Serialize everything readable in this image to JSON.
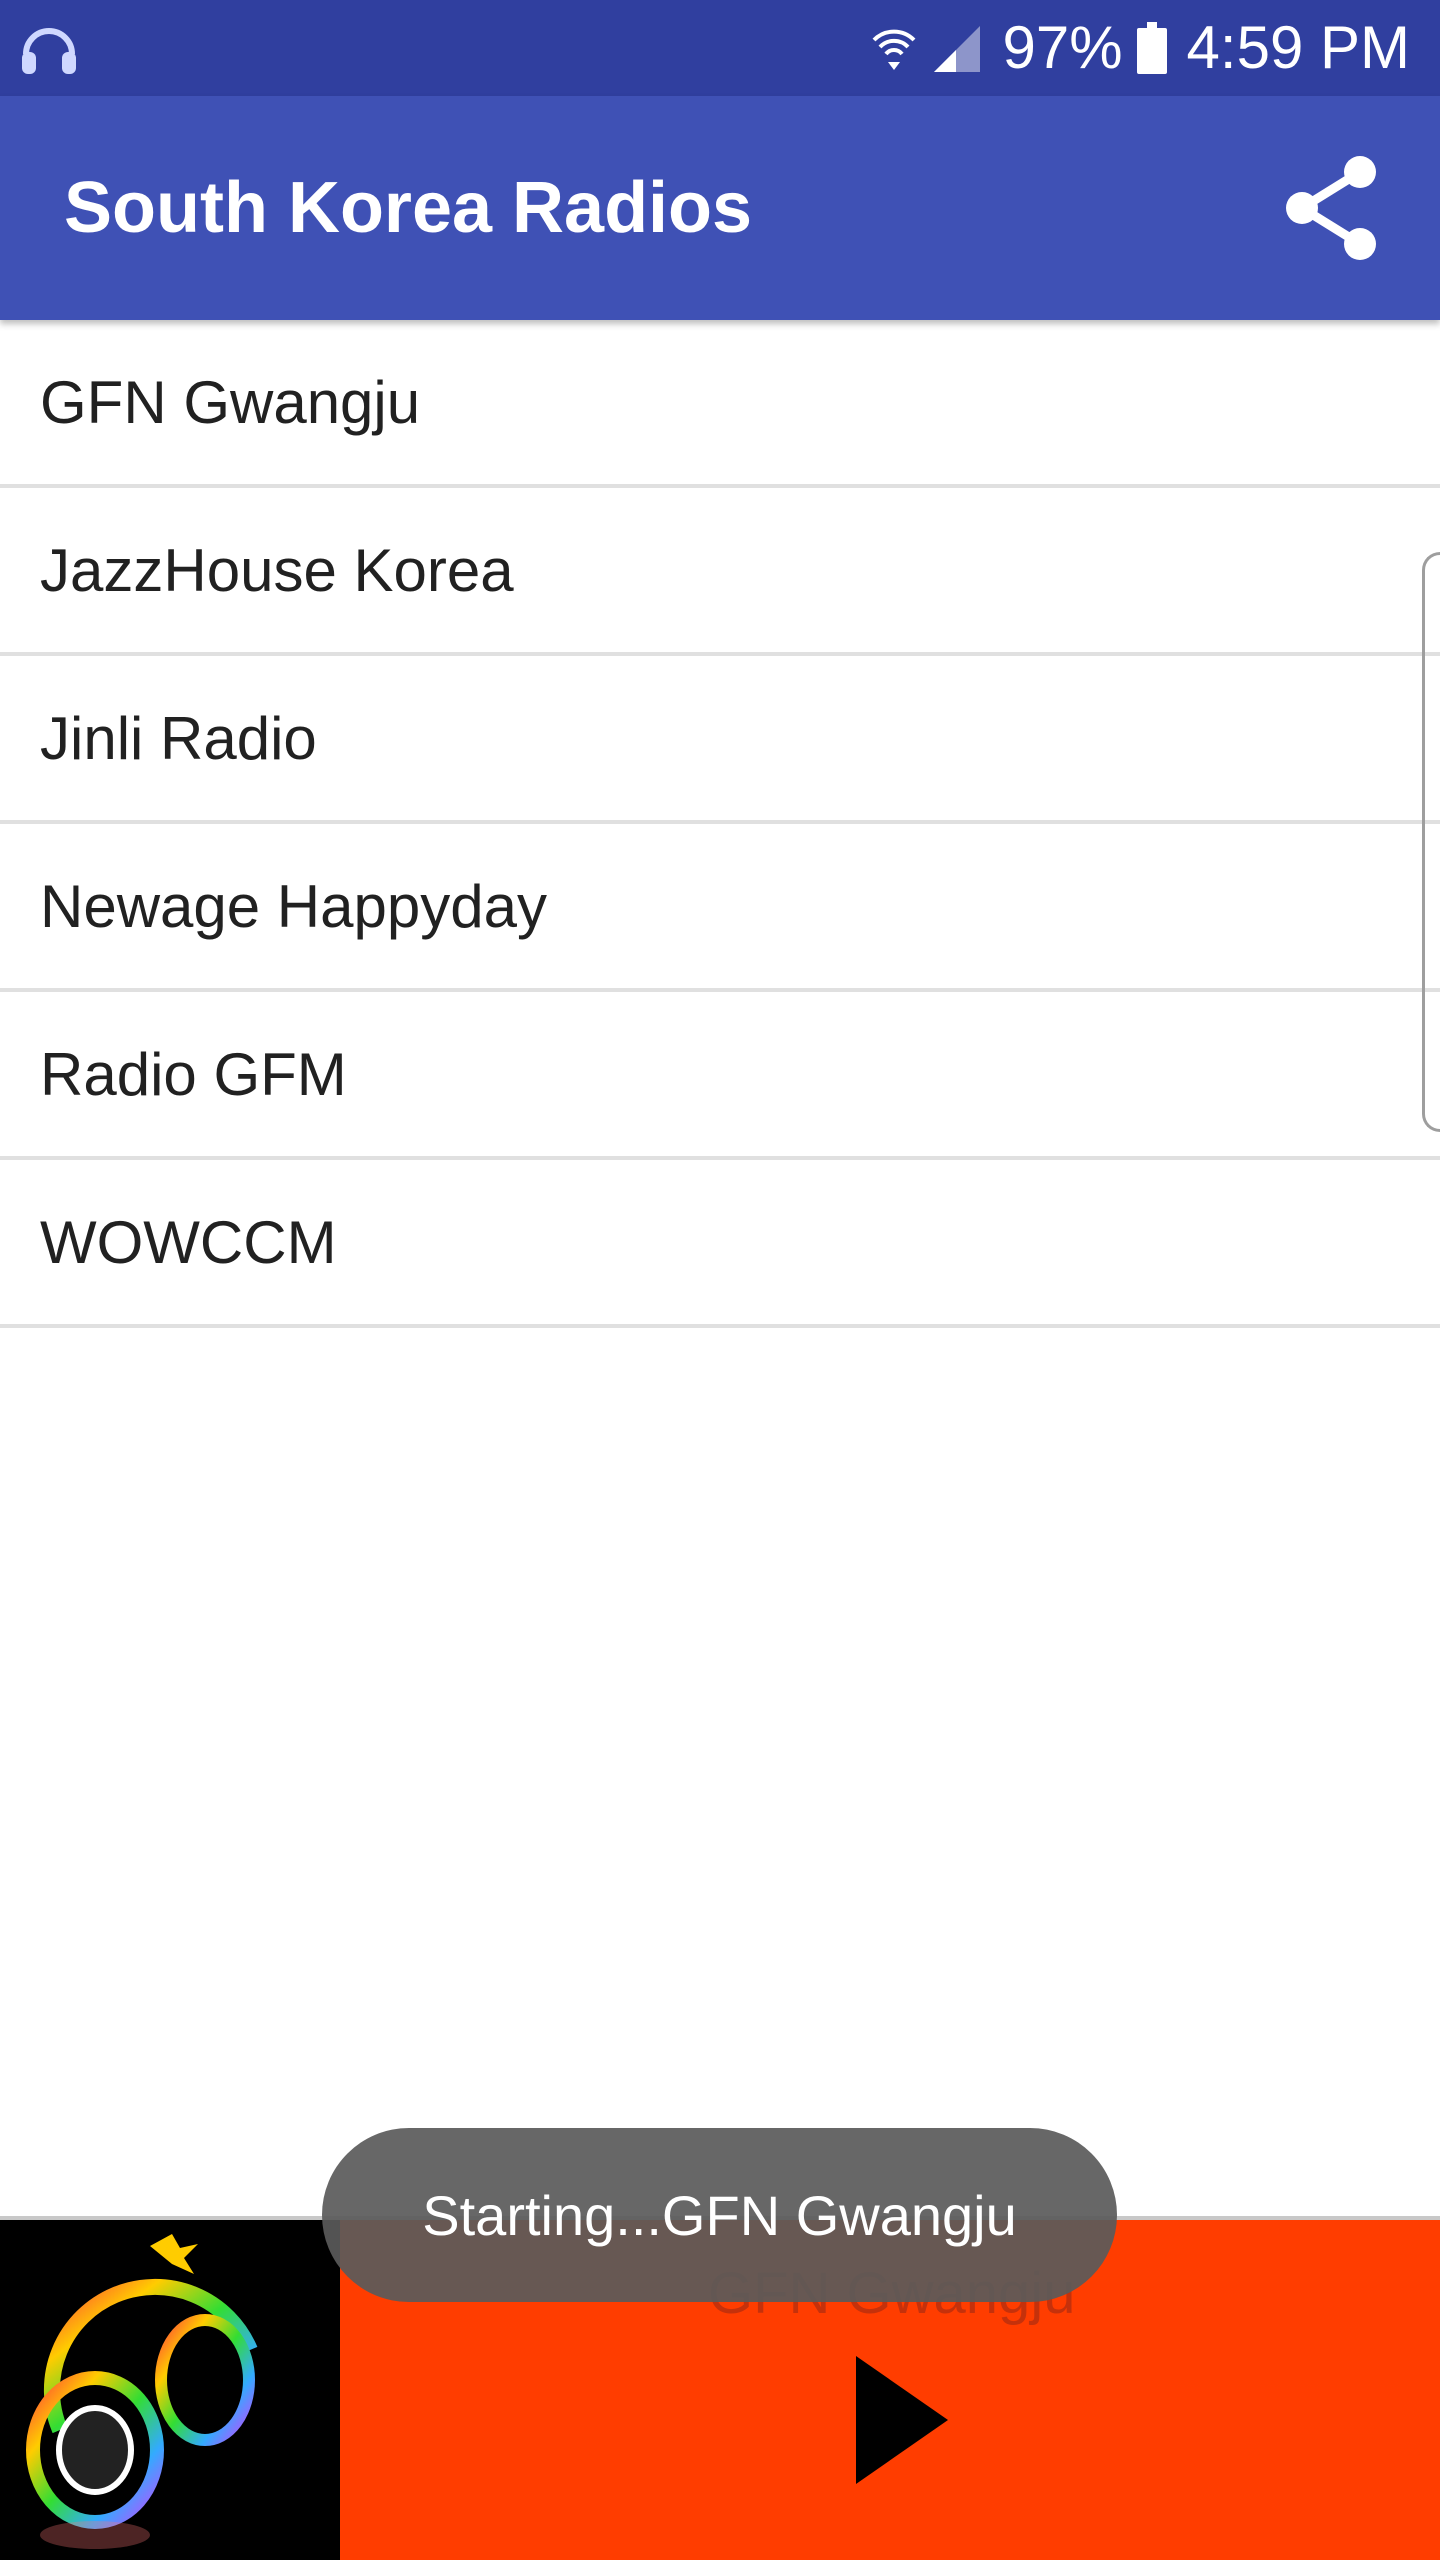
{
  "status_bar": {
    "left_icon": "headphones-icon",
    "wifi_icon": "wifi-icon",
    "signal_icon": "signal-icon",
    "battery_percent": "97%",
    "battery_icon": "battery-icon",
    "time": "4:59 PM"
  },
  "app_bar": {
    "title": "South Korea Radios",
    "share_icon": "share-icon"
  },
  "stations": [
    {
      "label": "GFN Gwangju"
    },
    {
      "label": "JazzHouse Korea"
    },
    {
      "label": "Jinli Radio"
    },
    {
      "label": "Newage Happyday"
    },
    {
      "label": "Radio GFM"
    },
    {
      "label": "WOWCCM"
    }
  ],
  "player": {
    "album_art": "headphones-art",
    "now_playing": "GFN Gwangju",
    "play_icon": "play-icon",
    "background_color": "#ff3d00"
  },
  "toast": {
    "message": "Starting...GFN Gwangju"
  },
  "colors": {
    "status_bar": "#303f9f",
    "app_bar": "#3f51b5",
    "divider": "#e0e0e0"
  }
}
